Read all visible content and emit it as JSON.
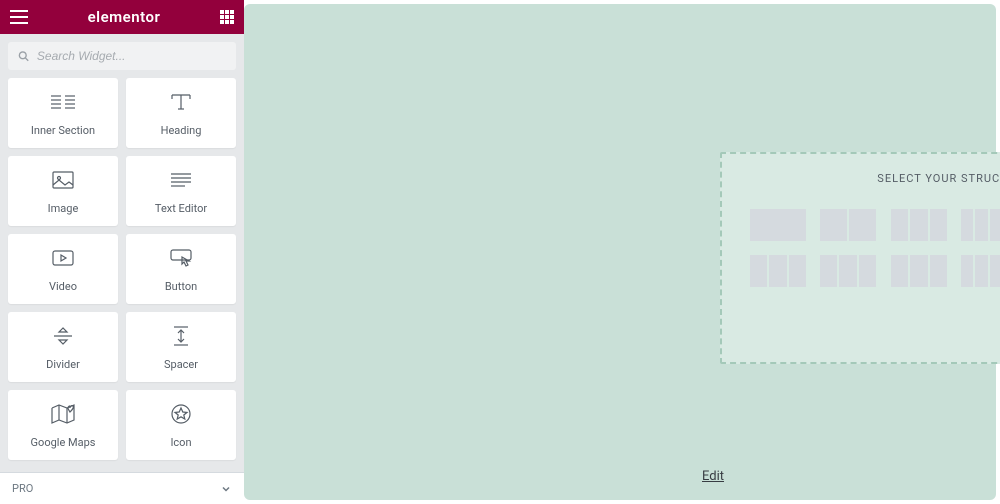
{
  "header": {
    "logo": "elementor"
  },
  "search": {
    "placeholder": "Search Widget..."
  },
  "widgets": [
    {
      "label": "Inner Section",
      "icon": "inner-section"
    },
    {
      "label": "Heading",
      "icon": "heading"
    },
    {
      "label": "Image",
      "icon": "image"
    },
    {
      "label": "Text Editor",
      "icon": "text-editor"
    },
    {
      "label": "Video",
      "icon": "video"
    },
    {
      "label": "Button",
      "icon": "button"
    },
    {
      "label": "Divider",
      "icon": "divider"
    },
    {
      "label": "Spacer",
      "icon": "spacer"
    },
    {
      "label": "Google Maps",
      "icon": "google-maps"
    },
    {
      "label": "Icon",
      "icon": "icon"
    }
  ],
  "pro": {
    "label": "PRO"
  },
  "structure": {
    "title": "SELECT YOUR STRUCTURE",
    "options": [
      {
        "cols": [
          56
        ]
      },
      {
        "cols": [
          27,
          27
        ]
      },
      {
        "cols": [
          17,
          18,
          17
        ]
      },
      {
        "cols": [
          12,
          13,
          13,
          12
        ]
      },
      {
        "cols": [
          10,
          10,
          10,
          10,
          10
        ]
      },
      {
        "cols": [
          27,
          27
        ]
      },
      {
        "cols": [
          17,
          18,
          17
        ]
      },
      {
        "cols": [
          17,
          18,
          17
        ]
      },
      {
        "cols": [
          17,
          18,
          17
        ]
      },
      {
        "cols": [
          12,
          13,
          13,
          12
        ]
      },
      {
        "cols": [
          17,
          35
        ]
      },
      {
        "cols": [
          8,
          9,
          8,
          9,
          8,
          8
        ],
        "selected": true
      }
    ]
  },
  "edit": {
    "label": "Edit"
  }
}
